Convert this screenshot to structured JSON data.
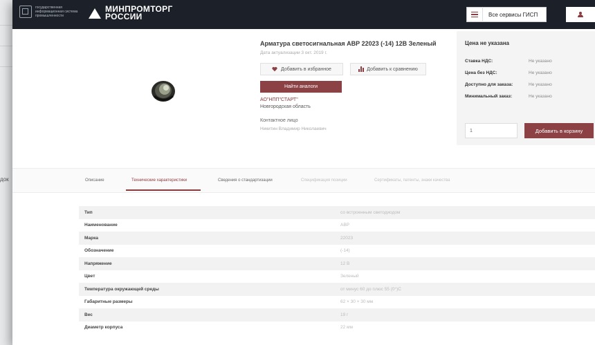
{
  "background": {
    "left_text": "док"
  },
  "header": {
    "gisp_text": "государственная информационная система промышленности",
    "ministry_line1": "МИНПРОМТОРГ",
    "ministry_line2": "РОССИИ",
    "services_label": "Все сервисы ГИСП"
  },
  "product": {
    "title": "Арматура светосигнальная АВР 22023 (-14) 12В Зеленый",
    "date": "Дата актуализации 3 окт. 2019 г.",
    "favorite_label": "Добавить в избранное",
    "compare_label": "Добавить к сравнению",
    "analogs_label": "Найти аналоги",
    "supplier": "АО\"НПП\"СТАРТ\"",
    "region": "Новгородская область",
    "contact_label": "Контактное лицо",
    "contact_name": "Никитин Владимир Николаевич"
  },
  "price": {
    "title": "Цена не указана",
    "rows": [
      {
        "k": "Ставка НДС:",
        "v": "Не указано"
      },
      {
        "k": "Цена без НДС:",
        "v": "Не указано"
      },
      {
        "k": "Доступно для заказа:",
        "v": "Не указано"
      },
      {
        "k": "Минимальный заказ:",
        "v": "Не указано"
      }
    ],
    "quantity": "1",
    "cart_label": "Добавить в корзину"
  },
  "tabs": [
    {
      "label": "Описание",
      "state": "normal"
    },
    {
      "label": "Технические характеристики",
      "state": "active"
    },
    {
      "label": "Сведения о стандартизации",
      "state": "normal"
    },
    {
      "label": "Спецификация позиции",
      "state": "disabled"
    },
    {
      "label": "Сертификаты, патенты, знаки качества",
      "state": "disabled"
    }
  ],
  "specs": [
    {
      "k": "Тип",
      "v": "со встроенным светодиодом"
    },
    {
      "k": "Наименование",
      "v": "АВР"
    },
    {
      "k": "Марка",
      "v": "22023"
    },
    {
      "k": "Обозначение",
      "v": "(-14)"
    },
    {
      "k": "Напряжение",
      "v": "12 В"
    },
    {
      "k": "Цвет",
      "v": "Зеленый"
    },
    {
      "k": "Температура окружающей среды",
      "v": "от минус 60 до плюс 55 (0°)С"
    },
    {
      "k": "Габаритные размеры",
      "v": "62 × 30 × 30 мм"
    },
    {
      "k": "Вес",
      "v": "19 г"
    },
    {
      "k": "Диаметр корпуса",
      "v": "22 мм"
    }
  ],
  "colors": {
    "accent": "#8c4145",
    "header_bg": "#1b2029"
  }
}
